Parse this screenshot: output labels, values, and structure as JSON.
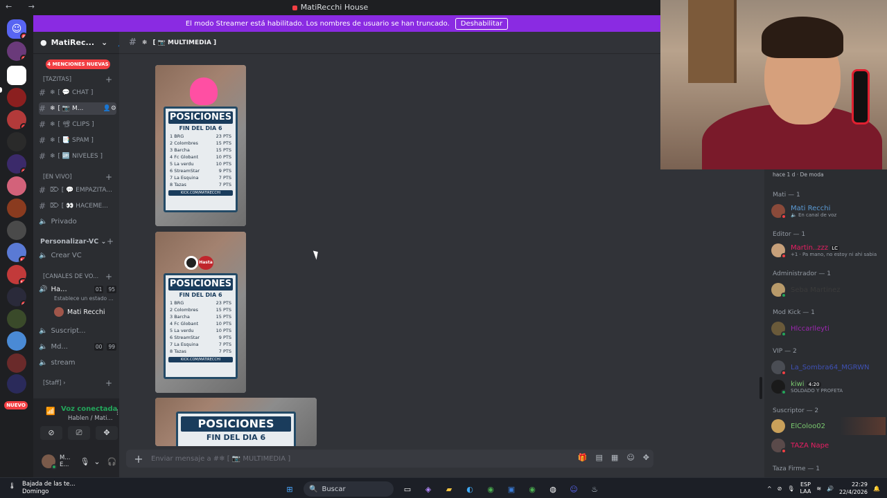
{
  "window": {
    "title": "MatiRecchi House"
  },
  "banner": {
    "text": "El modo Streamer está habilitado. Los nombres de usuario se han truncado.",
    "button": "Deshabilitar"
  },
  "rail": {
    "badges": [
      "8",
      "1",
      "4",
      "1",
      "12",
      "16",
      "9",
      "4"
    ],
    "nuevo": "NUEVO"
  },
  "sidebar": {
    "server_name": "MatiRec...",
    "mentions": "4 MENCIONES NUEVAS",
    "cat_tazitas": "[TAZITAS]",
    "channels": [
      {
        "label": "[ 💬 CHAT ]"
      },
      {
        "label": "[ 📷 M..."
      },
      {
        "label": "[ 📽 CLIPS ]"
      },
      {
        "label": "[ 📑 SPAM ]"
      },
      {
        "label": "[ 🆙 NIVELES ]"
      }
    ],
    "cat_envivo": "[EN VIVO]",
    "live_channels": [
      {
        "label": "[ 💬 EMPAZITA..."
      },
      {
        "label": "[ 👀 HACEME..."
      }
    ],
    "privado": "Privado",
    "cat_personalizar": "Personalizar-VC",
    "crear_vc": "Crear VC",
    "cat_canales": "[CANALES DE VO...",
    "voice": [
      {
        "label": "Ha...",
        "a": "01",
        "b": "95"
      },
      {
        "label": "Suscript..."
      },
      {
        "label": "Md...",
        "a": "00",
        "b": "99"
      },
      {
        "label": "stream"
      }
    ],
    "status_hint": "Establece un estado ...",
    "voice_user": "Mati Recchi",
    "cat_staff": "[Staff]",
    "voice_connected": "Voz conectada",
    "voice_connected_sub": "Hablen / Mati...",
    "user_short": "M...",
    "user_short2": "E..."
  },
  "chat": {
    "channel_name": "[ 📷 MULTIMEDIA ]",
    "composer_placeholder": "Enviar mensaje a #❄ [ 📷 MULTIMEDIA ]",
    "poster": {
      "title": "POSICIONES",
      "subtitle": "FIN DEL DIA 6",
      "footer": "KICK.COM/MATIRECCHI",
      "rows": [
        {
          "pos": "1",
          "team": "BRG",
          "pts": "23 PTS"
        },
        {
          "pos": "2",
          "team": "Colombres",
          "pts": "15 PTS"
        },
        {
          "pos": "3",
          "team": "Barcha",
          "pts": "15 PTS"
        },
        {
          "pos": "4",
          "team": "Fc Globant",
          "pts": "10 PTS"
        },
        {
          "pos": "5",
          "team": "La verdu",
          "pts": "10 PTS"
        },
        {
          "pos": "6",
          "team": "StreamStar",
          "pts": "9 PTS"
        },
        {
          "pos": "7",
          "team": "La Esquina",
          "pts": "7 PTS"
        },
        {
          "pos": "8",
          "team": "Tazas",
          "pts": "7 PTS"
        }
      ],
      "badge": "Hasta"
    }
  },
  "members": {
    "top_text": "hace 1 d  ·  De moda",
    "groups": [
      {
        "head": "Mati — 1",
        "names": [
          {
            "name": "Mati Recchi",
            "sub": "🔈 En canal de voz",
            "color": "#5b9bd5"
          }
        ]
      },
      {
        "head": "Editor — 1",
        "names": [
          {
            "name": "Martin..zzz",
            "sub": "+1 · Pa mano, no estoy ni ahi sabia",
            "color": "#e91e63",
            "tag": "LC"
          }
        ]
      },
      {
        "head": "Administrador — 1",
        "names": [
          {
            "name": "Seba Martinez",
            "sub": "",
            "color": "#3b3b3b"
          }
        ]
      },
      {
        "head": "Mod Kick — 1",
        "names": [
          {
            "name": "Hlccarlleyti",
            "sub": "",
            "color": "#9c27b0"
          }
        ]
      },
      {
        "head": "VIP — 2",
        "names": [
          {
            "name": "La_Sombra64_MGRWN",
            "sub": "",
            "color": "#3f51b5"
          },
          {
            "name": "kiwi",
            "sub": "SOLDADO Y PROFETA",
            "color": "#7bc96f",
            "tag": "4:20"
          }
        ]
      },
      {
        "head": "Suscriptor — 2",
        "names": [
          {
            "name": "ElColoo02",
            "sub": "",
            "color": "#7bc96f"
          },
          {
            "name": "TAZA Nape",
            "sub": "",
            "color": "#e91e63"
          }
        ]
      },
      {
        "head": "Taza Firme — 1",
        "names": []
      }
    ]
  },
  "taskbar": {
    "weather_title": "Bajada de las te...",
    "weather_sub": "Domingo",
    "search": "Buscar",
    "lang": "ESP",
    "lang2": "LAA",
    "time": "22:29",
    "date": "22/4/2026"
  }
}
